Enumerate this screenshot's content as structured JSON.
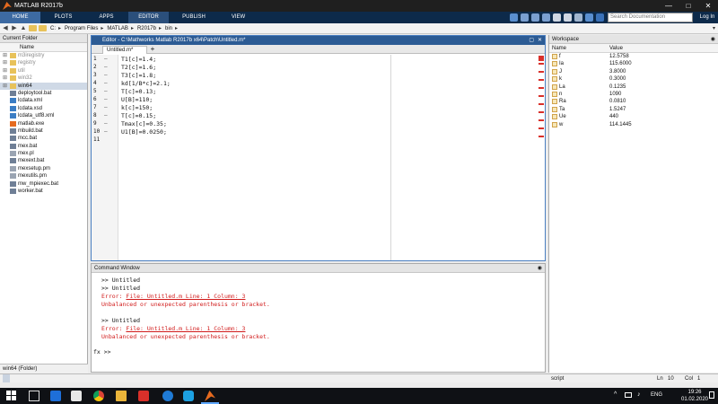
{
  "window": {
    "title": "MATLAB R2017b",
    "minimize": "—",
    "maximize": "□",
    "close": "✕"
  },
  "ribbon": {
    "tabs": [
      "HOME",
      "PLOTS",
      "APPS",
      "EDITOR",
      "PUBLISH",
      "VIEW"
    ],
    "search_placeholder": "Search Documentation",
    "login": "Log In"
  },
  "address": {
    "crumbs": [
      "C:",
      "Program Files",
      "MATLAB",
      "R2017b",
      "bin"
    ]
  },
  "current_folder": {
    "title": "Current Folder",
    "column": "Name",
    "items": [
      {
        "name": "m3iregistry",
        "type": "folder",
        "dim": true
      },
      {
        "name": "registry",
        "type": "folder",
        "dim": true
      },
      {
        "name": "util",
        "type": "folder",
        "dim": true
      },
      {
        "name": "win32",
        "type": "folder",
        "dim": true
      },
      {
        "name": "win64",
        "type": "folder",
        "dim": false
      },
      {
        "name": "deploytool.bat",
        "type": "bat"
      },
      {
        "name": "lcdata.xml",
        "type": "xml"
      },
      {
        "name": "lcdata.xsd",
        "type": "xml"
      },
      {
        "name": "lcdata_utf8.xml",
        "type": "xml"
      },
      {
        "name": "matlab.exe",
        "type": "exe"
      },
      {
        "name": "mbuild.bat",
        "type": "bat"
      },
      {
        "name": "mcc.bat",
        "type": "bat"
      },
      {
        "name": "mex.bat",
        "type": "bat"
      },
      {
        "name": "mex.pl",
        "type": "file"
      },
      {
        "name": "mexext.bat",
        "type": "bat"
      },
      {
        "name": "mexsetup.pm",
        "type": "file"
      },
      {
        "name": "mexutils.pm",
        "type": "file"
      },
      {
        "name": "mw_mpiexec.bat",
        "type": "bat"
      },
      {
        "name": "worker.bat",
        "type": "bat"
      }
    ],
    "status": "win64 (Folder)"
  },
  "editor": {
    "title": "Editor - C:\\Mathworks Matlab R2017b x64\\Patch\\Untitled.m*",
    "tab": "Untitled.m*",
    "lines": [
      "T1[c]=1.4;",
      "T2[c]=1.6;",
      "T3[c]=1.8;",
      "kd[1/B*c]=2.1;",
      "T[c]=0.13;",
      "U[B]=110;",
      "k[c]=150;",
      "T[c]=0.15;",
      "Tmax[c]=0.35;",
      "U1[B]=0.0250;",
      ""
    ]
  },
  "command_window": {
    "title": "Command Window",
    "lines": [
      {
        "text": ">> Untitled",
        "kind": "normal"
      },
      {
        "text": ">> Untitled",
        "kind": "normal"
      },
      {
        "text": "Error: ",
        "link": "File: Untitled.m Line: 1 Column: 3",
        "kind": "error"
      },
      {
        "text": "Unbalanced or unexpected parenthesis or bracket.",
        "kind": "error"
      },
      {
        "text": "",
        "kind": "normal"
      },
      {
        "text": ">> Untitled",
        "kind": "normal"
      },
      {
        "text": "Error: ",
        "link": "File: Untitled.m Line: 1 Column: 3",
        "kind": "error"
      },
      {
        "text": "Unbalanced or unexpected parenthesis or bracket.",
        "kind": "error"
      }
    ],
    "prompt": "fx >>"
  },
  "workspace": {
    "title": "Workspace",
    "columns": [
      "Name",
      "Value"
    ],
    "vars": [
      {
        "name": "f",
        "value": "12.5758"
      },
      {
        "name": "Ia",
        "value": "115.6000"
      },
      {
        "name": "J",
        "value": "3.8000"
      },
      {
        "name": "k",
        "value": "0.3000"
      },
      {
        "name": "La",
        "value": "0.1235"
      },
      {
        "name": "n",
        "value": "1090"
      },
      {
        "name": "Ra",
        "value": "0.0810"
      },
      {
        "name": "Ta",
        "value": "1.5247"
      },
      {
        "name": "Ue",
        "value": "440"
      },
      {
        "name": "w",
        "value": "114.1445"
      }
    ]
  },
  "status_bar": {
    "mode": "script",
    "ln_label": "Ln",
    "ln": "10",
    "col_label": "Col",
    "col": "1"
  },
  "taskbar": {
    "lang": "ENG",
    "time": "19:26",
    "date": "01.02.2020"
  },
  "colors": {
    "ribbon": "#0d2a4a",
    "editor_title": "#2c5b94",
    "error": "#d11b1b"
  }
}
